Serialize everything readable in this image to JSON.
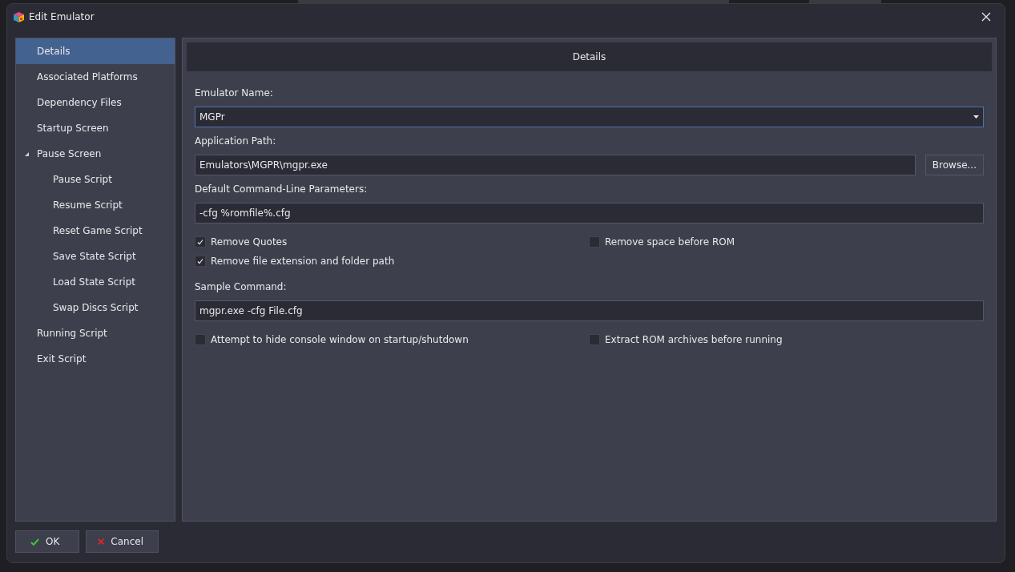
{
  "window": {
    "title": "Edit Emulator"
  },
  "sidebar": {
    "items": [
      {
        "label": "Details",
        "selected": true
      },
      {
        "label": "Associated Platforms",
        "selected": false
      },
      {
        "label": "Dependency Files",
        "selected": false
      },
      {
        "label": "Startup Screen",
        "selected": false
      },
      {
        "label": "Pause Screen",
        "selected": false,
        "expanded": true,
        "children": [
          {
            "label": "Pause Script",
            "selected": false
          },
          {
            "label": "Resume Script",
            "selected": false
          },
          {
            "label": "Reset Game Script",
            "selected": false
          },
          {
            "label": "Save State Script",
            "selected": false
          },
          {
            "label": "Load State Script",
            "selected": false
          },
          {
            "label": "Swap Discs Script",
            "selected": false
          }
        ]
      },
      {
        "label": "Running Script",
        "selected": false
      },
      {
        "label": "Exit Script",
        "selected": false
      }
    ]
  },
  "panel": {
    "title": "Details",
    "emulator_name": {
      "label": "Emulator Name:",
      "value": "MGPr"
    },
    "application_path": {
      "label": "Application Path:",
      "value": "Emulators\\MGPR\\mgpr.exe",
      "button": "Browse..."
    },
    "parameters": {
      "label": "Default Command-Line Parameters:",
      "value": "-cfg %romfile%.cfg"
    },
    "options_1": [
      {
        "label": "Remove Quotes",
        "checked": true
      },
      {
        "label": "Remove space before ROM",
        "checked": false
      },
      {
        "label": "Remove file extension and folder path",
        "checked": true
      }
    ],
    "sample_command": {
      "label": "Sample Command:",
      "value": "mgpr.exe -cfg File.cfg"
    },
    "options_2": [
      {
        "label": "Attempt to hide console window on startup/shutdown",
        "checked": false
      },
      {
        "label": "Extract ROM archives before running",
        "checked": false
      }
    ]
  },
  "buttons": [
    {
      "label": "OK",
      "kind": "ok"
    },
    {
      "label": "Cancel",
      "kind": "cancel"
    }
  ]
}
